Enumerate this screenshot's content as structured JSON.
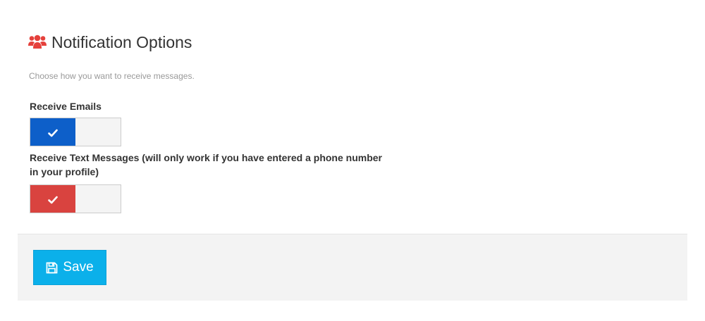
{
  "header": {
    "icon": "users-icon",
    "title": "Notification Options"
  },
  "subtitle": "Choose how you want to receive messages.",
  "options": [
    {
      "label": "Receive Emails",
      "checked": true,
      "on_color": "#0d5fc9",
      "icon": "check-icon"
    },
    {
      "label": "Receive Text Messages (will only work if you have entered a phone number in your profile)",
      "checked": true,
      "on_color": "#d9433f",
      "icon": "check-icon"
    }
  ],
  "footer": {
    "save_label": "Save",
    "save_icon": "floppy-disk-icon",
    "save_color": "#0bb0ea"
  },
  "colors": {
    "accent_red": "#e5413c",
    "footer_bg": "#f3f3f3"
  }
}
